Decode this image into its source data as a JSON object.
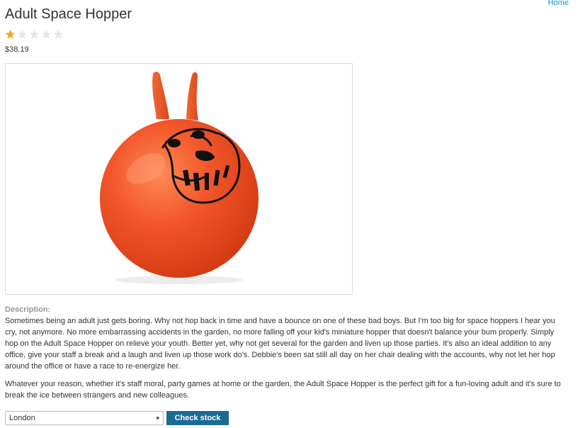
{
  "nav": {
    "home_label": "Home"
  },
  "product": {
    "title": "Adult Space Hopper",
    "rating": {
      "value": 1,
      "max": 5
    },
    "price": "$38.19",
    "image_icon": "space-hopper-image"
  },
  "description": {
    "label": "Description:",
    "paragraphs": [
      "Sometimes being an adult just gets boring. Why not hop back in time and have a bounce on one of these bad boys. But I'm too big for space hoppers I hear you cry, not anymore. No more embarrassing accidents in the garden, no more falling off your kid's miniature hopper that doesn't balance your bum properly. Simply hop on the Adult Space Hopper on relieve your youth. Better yet, why not get several for the garden and liven up those parties. It's also an ideal addition to any office, give your staff a break and a laugh and liven up those work do's. Debbie's been sat still all day on her chair dealing with the accounts, why not let her hop around the office or have a race to re-energize her.",
      "Whatever your reason, whether it's staff moral, party games at home or the garden, the Adult Space Hopper is the perfect gift for a fun-loving adult and it's sure to break the ice between strangers and new colleagues."
    ]
  },
  "stock": {
    "selected_store": "London",
    "button_label": "Check stock"
  },
  "colors": {
    "star_filled": "#f5a623",
    "star_empty": "#e5e5e5",
    "button": "#1b6b93",
    "link": "#1a8fd0",
    "hopper": "#ee5a24"
  }
}
